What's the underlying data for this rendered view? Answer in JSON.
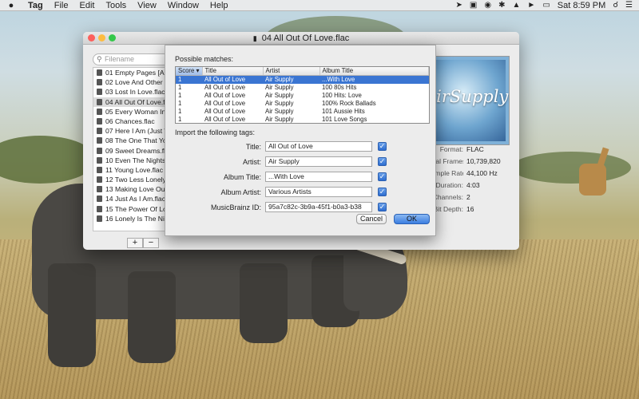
{
  "menubar": {
    "apple": "",
    "app_name": "Tag",
    "menus": [
      "File",
      "Edit",
      "Tools",
      "View",
      "Window",
      "Help"
    ],
    "clock": "Sat 8:59 PM"
  },
  "window": {
    "title": "04 All Out Of Love.flac",
    "search_placeholder": "Filename",
    "files": [
      "01 Empty Pages [Album Version].flac",
      "02 Love And Other Bruises.flac",
      "03 Lost In Love.flac",
      "04 All Out Of Love.flac",
      "05 Every Woman In The World.flac",
      "06 Chances.flac",
      "07 Here I Am (Just When I Thought).flac",
      "08 The One That You Love.flac",
      "09 Sweet Dreams.flac",
      "10 Even The Nights Are Better.flac",
      "11 Young Love.flac",
      "12 Two Less Lonely People.flac",
      "13 Making Love Out Of Nothing.flac",
      "14 Just As I Am.flac",
      "15 The Power Of Love.flac",
      "16 Lonely Is The Night.flac"
    ],
    "selected_file_index": 3,
    "add_label": "+",
    "remove_label": "−",
    "album_art_text": "AirSupply",
    "info": [
      {
        "key": "Format:",
        "value": "FLAC"
      },
      {
        "key": "Total Frames:",
        "value": "10,739,820"
      },
      {
        "key": "Sample Rate:",
        "value": "44,100 Hz"
      },
      {
        "key": "Duration:",
        "value": "4:03"
      },
      {
        "key": "Channels:",
        "value": "2"
      },
      {
        "key": "Bit Depth:",
        "value": "16"
      }
    ]
  },
  "sheet": {
    "matches_label": "Possible matches:",
    "columns": [
      "Score",
      "Title",
      "Artist",
      "Album Title"
    ],
    "rows": [
      [
        "1",
        "All Out of Love",
        "Air Supply",
        "...With Love"
      ],
      [
        "1",
        "All Out of Love",
        "Air Supply",
        "100 80s Hits"
      ],
      [
        "1",
        "All Out of Love",
        "Air Supply",
        "100 Hits: Love"
      ],
      [
        "1",
        "All Out of Love",
        "Air Supply",
        "100% Rock Ballads"
      ],
      [
        "1",
        "All Out of Love",
        "Air Supply",
        "101 Aussie Hits"
      ],
      [
        "1",
        "All Out of Love",
        "Air Supply",
        "101 Love Songs"
      ]
    ],
    "selected_row": 0,
    "import_label": "Import the following tags:",
    "fields": [
      {
        "label": "Title:",
        "value": "All Out of Love",
        "checked": true
      },
      {
        "label": "Artist:",
        "value": "Air Supply",
        "checked": true
      },
      {
        "label": "Album Title:",
        "value": "...With Love",
        "checked": true
      },
      {
        "label": "Album Artist:",
        "value": "Various Artists",
        "checked": true
      },
      {
        "label": "MusicBrainz ID:",
        "value": "95a7c82c-3b9a-45f1-b0a3-b38",
        "checked": true
      }
    ],
    "cancel_label": "Cancel",
    "ok_label": "OK"
  }
}
